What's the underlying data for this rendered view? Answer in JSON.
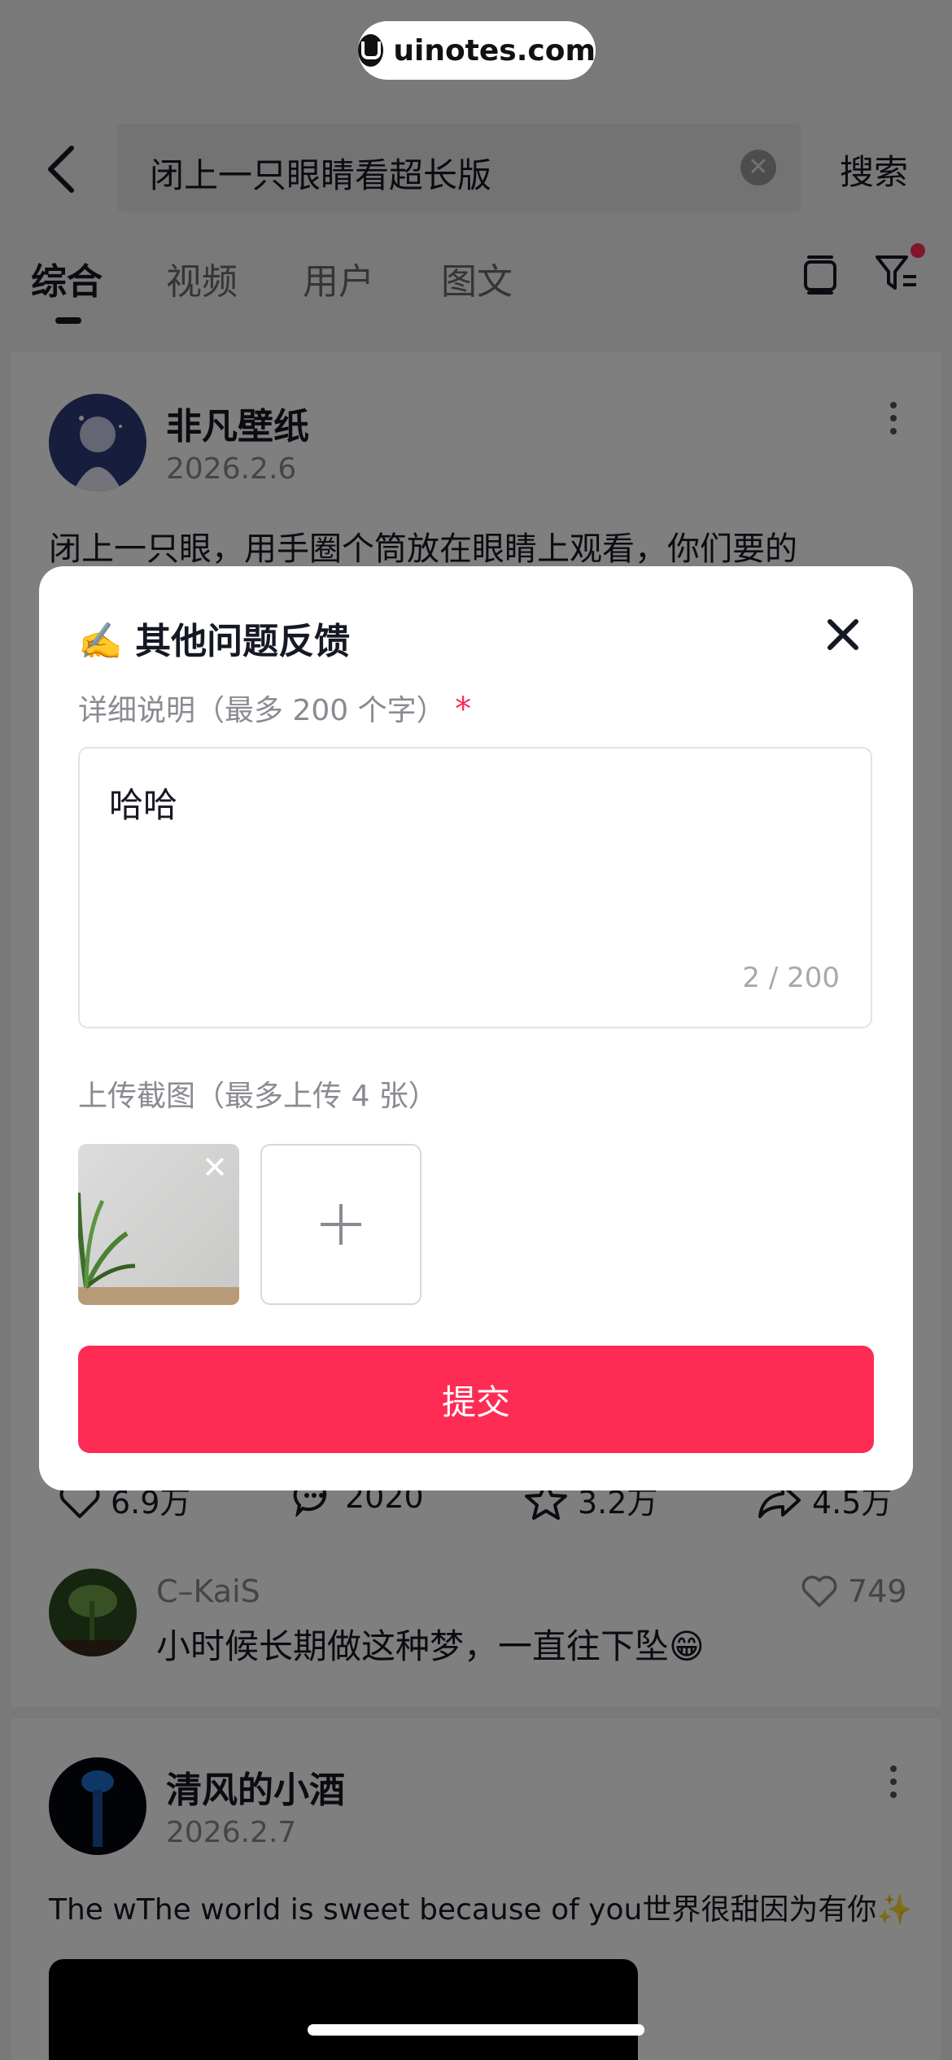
{
  "watermark": {
    "text": "uinotes.com"
  },
  "search": {
    "query": "闭上一只眼睛看超长版",
    "search_label": "搜索"
  },
  "tabs": [
    {
      "label": "综合",
      "active": true
    },
    {
      "label": "视频",
      "active": false
    },
    {
      "label": "用户",
      "active": false
    },
    {
      "label": "图文",
      "active": false
    }
  ],
  "post1": {
    "author": "非凡壁纸",
    "date": "2026.2.6",
    "text": "闭上一只眼，用手圈个筒放在眼睛上观看，你们要的",
    "stats": {
      "likes": "6.9万",
      "comments": "2020",
      "favorites": "3.2万",
      "shares": "4.5万"
    },
    "top_comment": {
      "user": "C–KaiS",
      "text": "小时候长期做这种梦，一直往下坠😁",
      "likes": "749"
    }
  },
  "post2": {
    "author": "清风的小酒",
    "date": "2026.2.7",
    "text": "The wThe world is sweet because of you世界很甜因为有你✨"
  },
  "modal": {
    "title": "✍️ 其他问题反馈",
    "detail_label": "详细说明（最多 200 个字）",
    "required_mark": "*",
    "detail_value": "哈哈",
    "char_count": "2 / 200",
    "upload_label": "上传截图（最多上传 4 张）",
    "submit_label": "提交"
  },
  "colors": {
    "accent": "#fe2c55",
    "overlay": "rgba(0,0,0,0.5)"
  }
}
